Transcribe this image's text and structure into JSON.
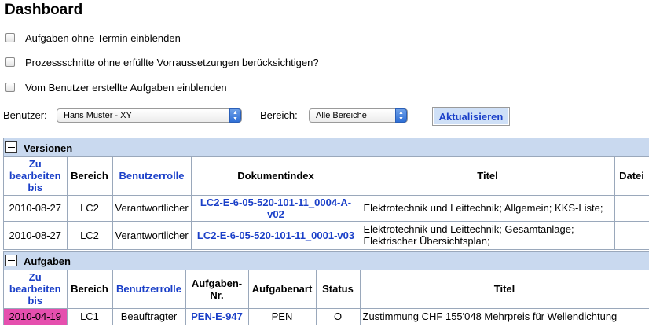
{
  "page": {
    "title": "Dashboard"
  },
  "options": [
    {
      "label": "Aufgaben ohne Termin einblenden",
      "checked": false
    },
    {
      "label": "Prozessschritte ohne erfüllte Vorraussetzungen berücksichtigen?",
      "checked": false
    },
    {
      "label": "Vom Benutzer erstellte Aufgaben einblenden",
      "checked": false
    }
  ],
  "filters": {
    "user_label": "Benutzer:",
    "user_value": "Hans Muster - XY",
    "area_label": "Bereich:",
    "area_value": "Alle Bereiche",
    "refresh_label": "Aktualisieren"
  },
  "versions": {
    "title": "Versionen",
    "headers": [
      "Zu bearbeiten bis",
      "Bereich",
      "Benutzerrolle",
      "Dokumentindex",
      "Titel",
      "Datei"
    ],
    "rows": [
      {
        "date": "2010-08-27",
        "area": "LC2",
        "role": "Verantwortlicher",
        "doc": "LC2-E-6-05-520-101-11_0004-A-v02",
        "title": "Elektrotechnik und Leittechnik; Allgemein; KKS-Liste;",
        "file": ""
      },
      {
        "date": "2010-08-27",
        "area": "LC2",
        "role": "Verantwortlicher",
        "doc": "LC2-E-6-05-520-101-11_0001-v03",
        "title": "Elektrotechnik und Leittechnik; Gesamtanlage; Elektrischer Übersichtsplan;",
        "file": ""
      }
    ]
  },
  "tasks": {
    "title": "Aufgaben",
    "headers": [
      "Zu bearbeiten bis",
      "Bereich",
      "Benutzerrolle",
      "Aufgaben-Nr.",
      "Aufgabenart",
      "Status",
      "Titel"
    ],
    "rows": [
      {
        "date": "2010-04-19",
        "area": "LC1",
        "role": "Beauftragter",
        "number": "PEN-E-947",
        "type": "PEN",
        "status": "O",
        "title": "Zustimmung CHF 155'048 Mehrpreis für Wellendichtung"
      }
    ]
  },
  "colors": {
    "link": "#1a3fc8",
    "header_bg": "#c9d9ef",
    "overdue": "#e54fae"
  }
}
